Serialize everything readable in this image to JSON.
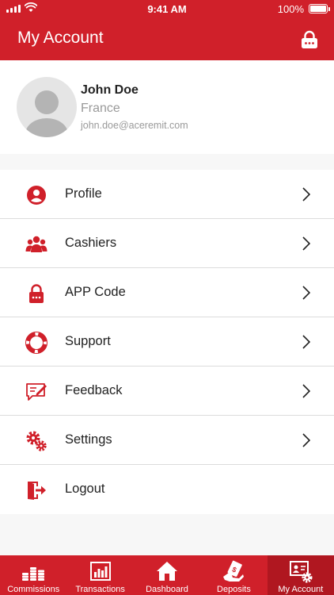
{
  "status_bar": {
    "time": "9:41 AM",
    "battery": "100%"
  },
  "header": {
    "title": "My Account"
  },
  "profile": {
    "name": "John Doe",
    "country": "France",
    "email": "john.doe@aceremit.com"
  },
  "menu": {
    "items": [
      {
        "label": "Profile",
        "icon": "user-circle-icon"
      },
      {
        "label": "Cashiers",
        "icon": "users-icon"
      },
      {
        "label": "APP Code",
        "icon": "lock-icon"
      },
      {
        "label": "Support",
        "icon": "lifebuoy-icon"
      },
      {
        "label": "Feedback",
        "icon": "feedback-icon"
      },
      {
        "label": "Settings",
        "icon": "gears-icon"
      },
      {
        "label": "Logout",
        "icon": "logout-icon"
      }
    ]
  },
  "tabs": [
    {
      "label": "Commissions",
      "icon": "coins-icon"
    },
    {
      "label": "Transactions",
      "icon": "bar-chart-icon"
    },
    {
      "label": "Dashboard",
      "icon": "home-icon"
    },
    {
      "label": "Deposits",
      "icon": "deposit-icon"
    },
    {
      "label": "My Account",
      "icon": "account-settings-icon",
      "active": true
    }
  ],
  "colors": {
    "brand": "#d0202a",
    "brand_dark": "#b01720"
  }
}
